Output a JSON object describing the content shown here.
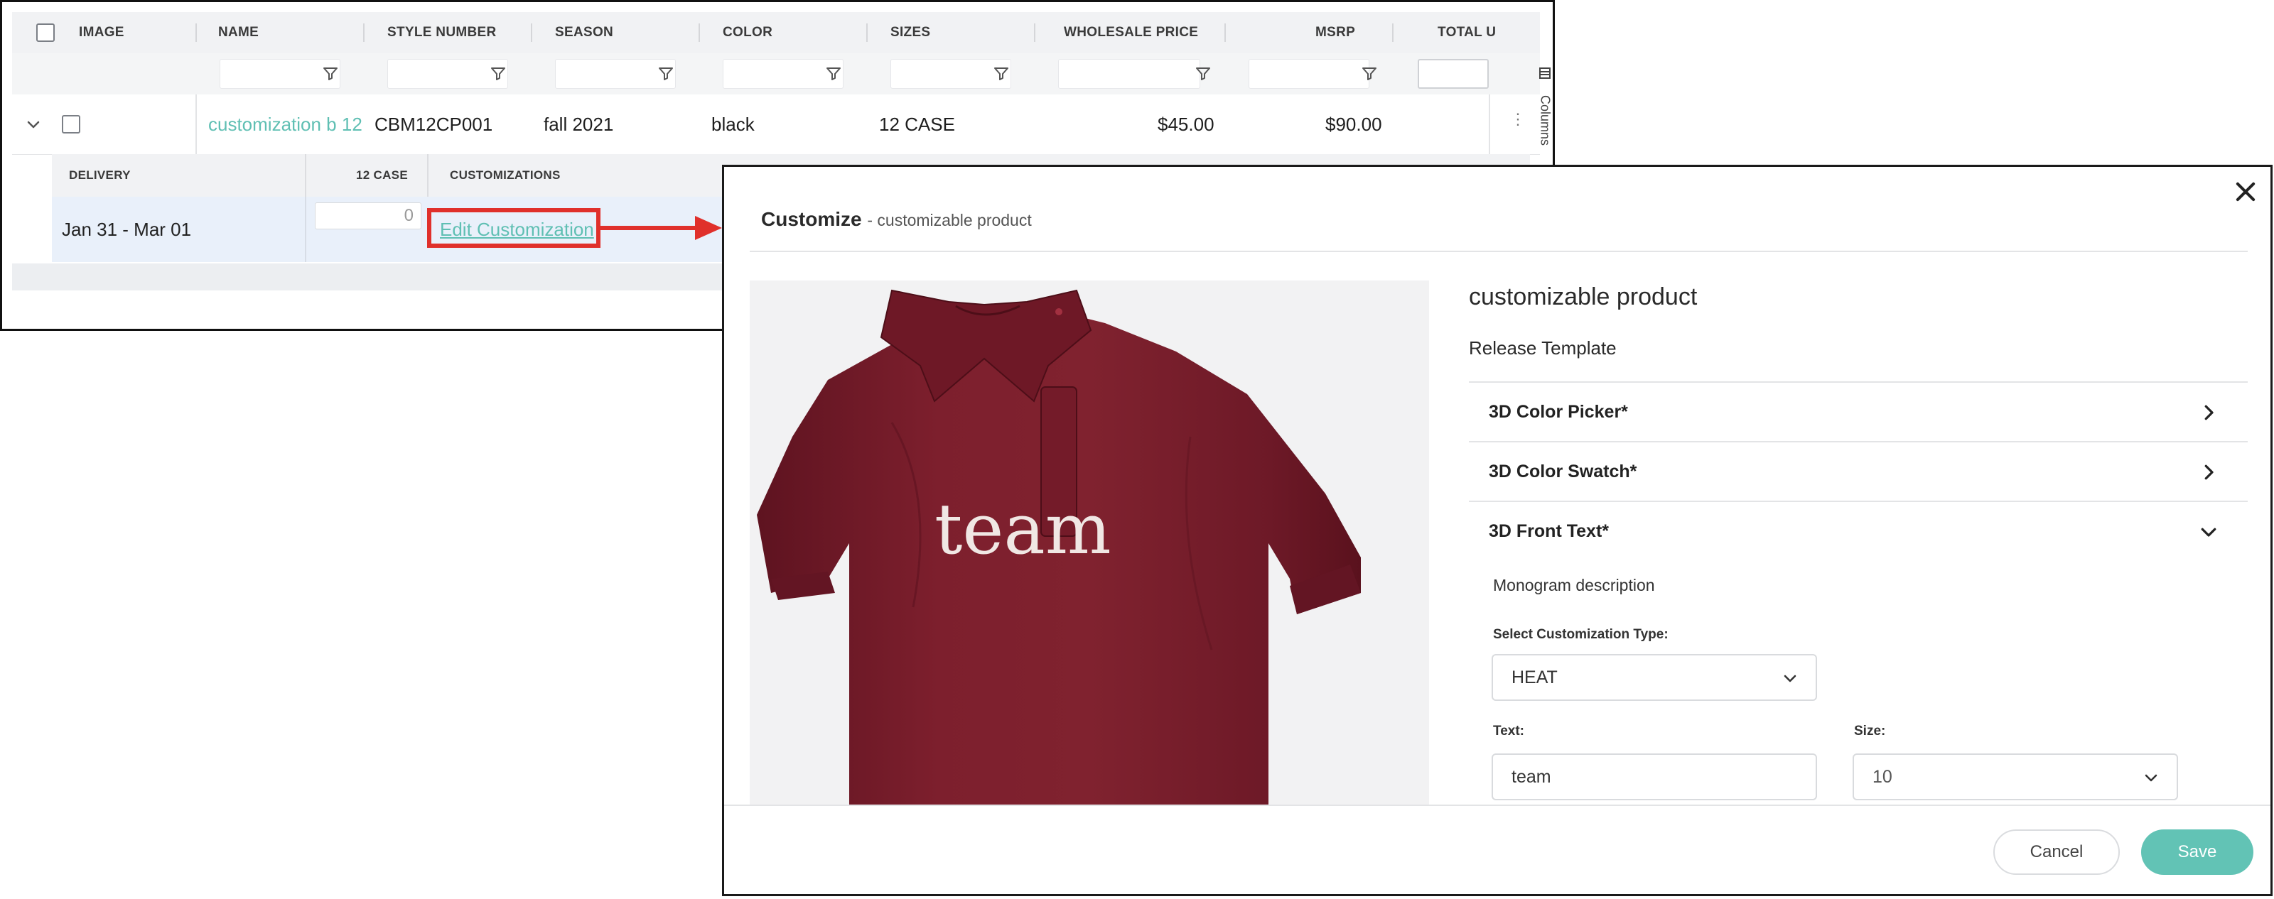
{
  "grid": {
    "headers": [
      "IMAGE",
      "NAME",
      "STYLE NUMBER",
      "SEASON",
      "COLOR",
      "SIZES",
      "WHOLESALE PRICE",
      "MSRP",
      "TOTAL U"
    ],
    "row": {
      "name": "customization b 12",
      "style_number": "CBM12CP001",
      "season": "fall 2021",
      "color": "black",
      "sizes": "12 CASE",
      "wholesale_price": "$45.00",
      "msrp": "$90.00"
    },
    "subgrid": {
      "headers": [
        "DELIVERY",
        "12 CASE",
        "CUSTOMIZATIONS"
      ],
      "delivery": "Jan 31 - Mar 01",
      "qty": "0",
      "edit_link": "Edit Customization"
    },
    "columns_tab": "Columns"
  },
  "modal": {
    "title": "Customize",
    "subtitle": "- customizable product",
    "product_name": "customizable product",
    "template": "Release Template",
    "accordion": [
      {
        "label": "3D Color Picker*",
        "state": "collapsed"
      },
      {
        "label": "3D Color Swatch*",
        "state": "collapsed"
      },
      {
        "label": "3D Front Text*",
        "state": "expanded"
      }
    ],
    "monogram_description": "Monogram description",
    "customization_type_label": "Select Customization Type:",
    "customization_type_value": "HEAT",
    "text_label": "Text:",
    "text_value": "team",
    "size_label": "Size:",
    "size_value": "10",
    "shirt_text": "team",
    "cancel_label": "Cancel",
    "save_label": "Save"
  },
  "colors": {
    "accent": "#62c3b5",
    "link": "#5fbfb3",
    "callout": "#e0302b",
    "shirt": "#7a1d2b"
  }
}
